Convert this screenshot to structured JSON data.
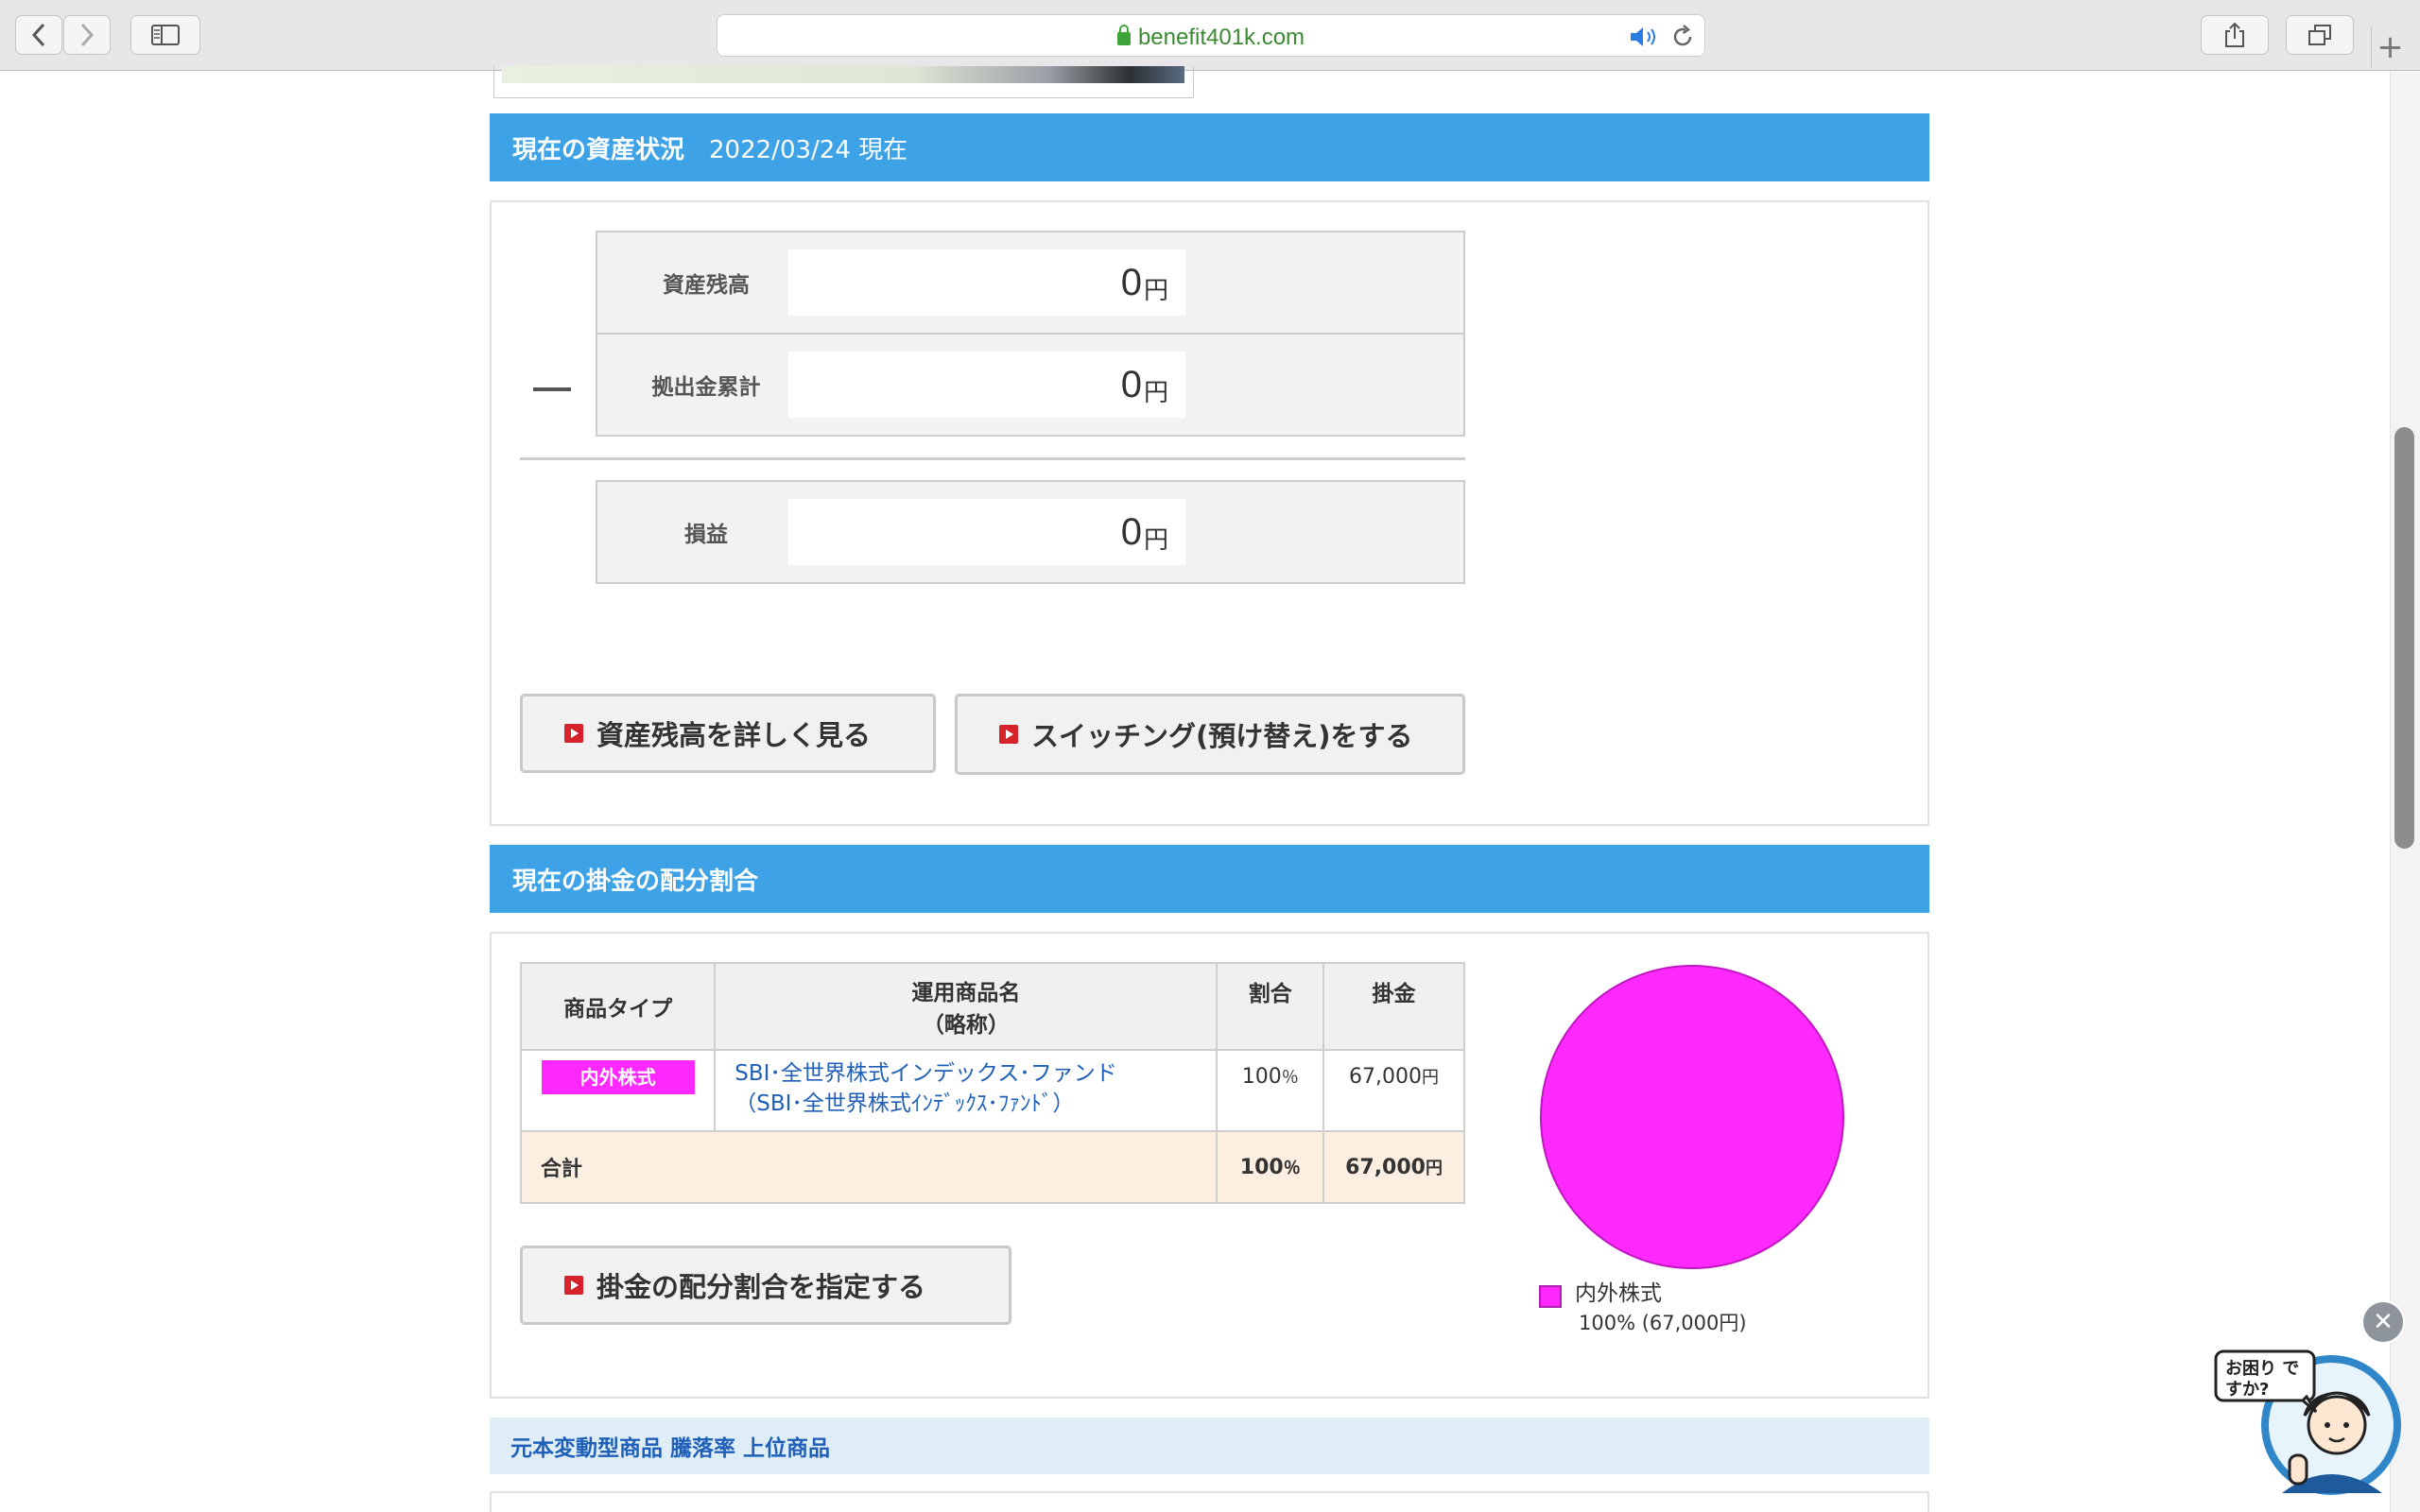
{
  "browser": {
    "url": "benefit401k.com",
    "icons": [
      "back-icon",
      "forward-icon",
      "sidebar-icon",
      "lock-icon",
      "speaker-icon",
      "reload-icon",
      "share-icon",
      "tabs-icon",
      "new-tab-icon"
    ]
  },
  "asset_section": {
    "title": "現在の資産状況",
    "date": "2022/03/24 現在",
    "rows": [
      {
        "label": "資産残高",
        "value": "0",
        "unit": "円"
      },
      {
        "label": "拠出金累計",
        "value": "0",
        "unit": "円"
      }
    ],
    "result": {
      "label": "損益",
      "value": "0",
      "unit": "円"
    },
    "minus_sign": "—",
    "buttons": {
      "detail": "資産残高を詳しく見る",
      "switching": "スイッチング(預け替え)をする"
    }
  },
  "allocation_section": {
    "title": "現在の掛金の配分割合",
    "columns": {
      "type": "商品タイプ",
      "name_line1": "運用商品名",
      "name_line2": "（略称）",
      "ratio": "割合",
      "amount": "掛金"
    },
    "rows": [
      {
        "type": "内外株式",
        "name": "SBI･全世界株式インデックス･ファンド",
        "short_name": "（SBI･全世界株式ｲﾝﾃﾞｯｸｽ･ﾌｧﾝﾄﾞ）",
        "ratio": "100",
        "ratio_unit": "％",
        "amount": "67,000",
        "amount_unit": "円"
      }
    ],
    "total": {
      "label": "合計",
      "ratio": "100",
      "ratio_unit": "％",
      "amount": "67,000",
      "amount_unit": "円"
    },
    "button": "掛金の配分割合を指定する",
    "legend": {
      "label": "内外株式",
      "detail": "100% (67,000円)"
    },
    "colors": {
      "stock": "#ff28ff"
    }
  },
  "ranking_section": {
    "title": "元本変動型商品 騰落率 上位商品"
  },
  "help_widget": {
    "bubble": "お困り ですか?"
  },
  "chart_data": {
    "type": "pie",
    "categories": [
      "内外株式"
    ],
    "values": [
      100
    ],
    "colors": [
      "#ff28ff"
    ],
    "legend": [
      "内外株式 100% (67,000円)"
    ]
  }
}
